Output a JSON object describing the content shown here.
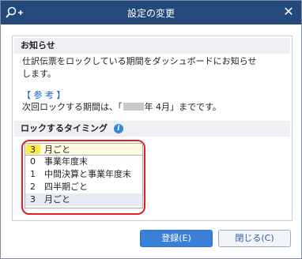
{
  "window": {
    "title": "設定の変更",
    "close_symbol": "✕",
    "app_icon": "search-plus-icon"
  },
  "notice": {
    "heading": "お知らせ",
    "line1": "仕訳伝票をロックしている期間をダッシュボードにお知らせ",
    "line2": "します。",
    "ref_label": "【 参 考 】",
    "next_prefix": "次回ロックする期間は、「",
    "next_suffix": "年 4月」までです。"
  },
  "lock_timing": {
    "heading": "ロックするタイミング",
    "info_icon": "i",
    "selected_num": "3",
    "selected_label": "月ごと",
    "options": [
      {
        "num": "0",
        "label": "事業年度末"
      },
      {
        "num": "1",
        "label": "中間決算と事業年度末"
      },
      {
        "num": "2",
        "label": "四半期ごと"
      },
      {
        "num": "3",
        "label": "月ごと"
      }
    ]
  },
  "buttons": {
    "register": "登録(E)",
    "close": "閉じる(C)"
  },
  "colors": {
    "titlebar": "#25497a",
    "accent_blue": "#3a7fd8",
    "highlight_yellow": "#ffe94a",
    "annotation_red": "#e41e1e"
  }
}
